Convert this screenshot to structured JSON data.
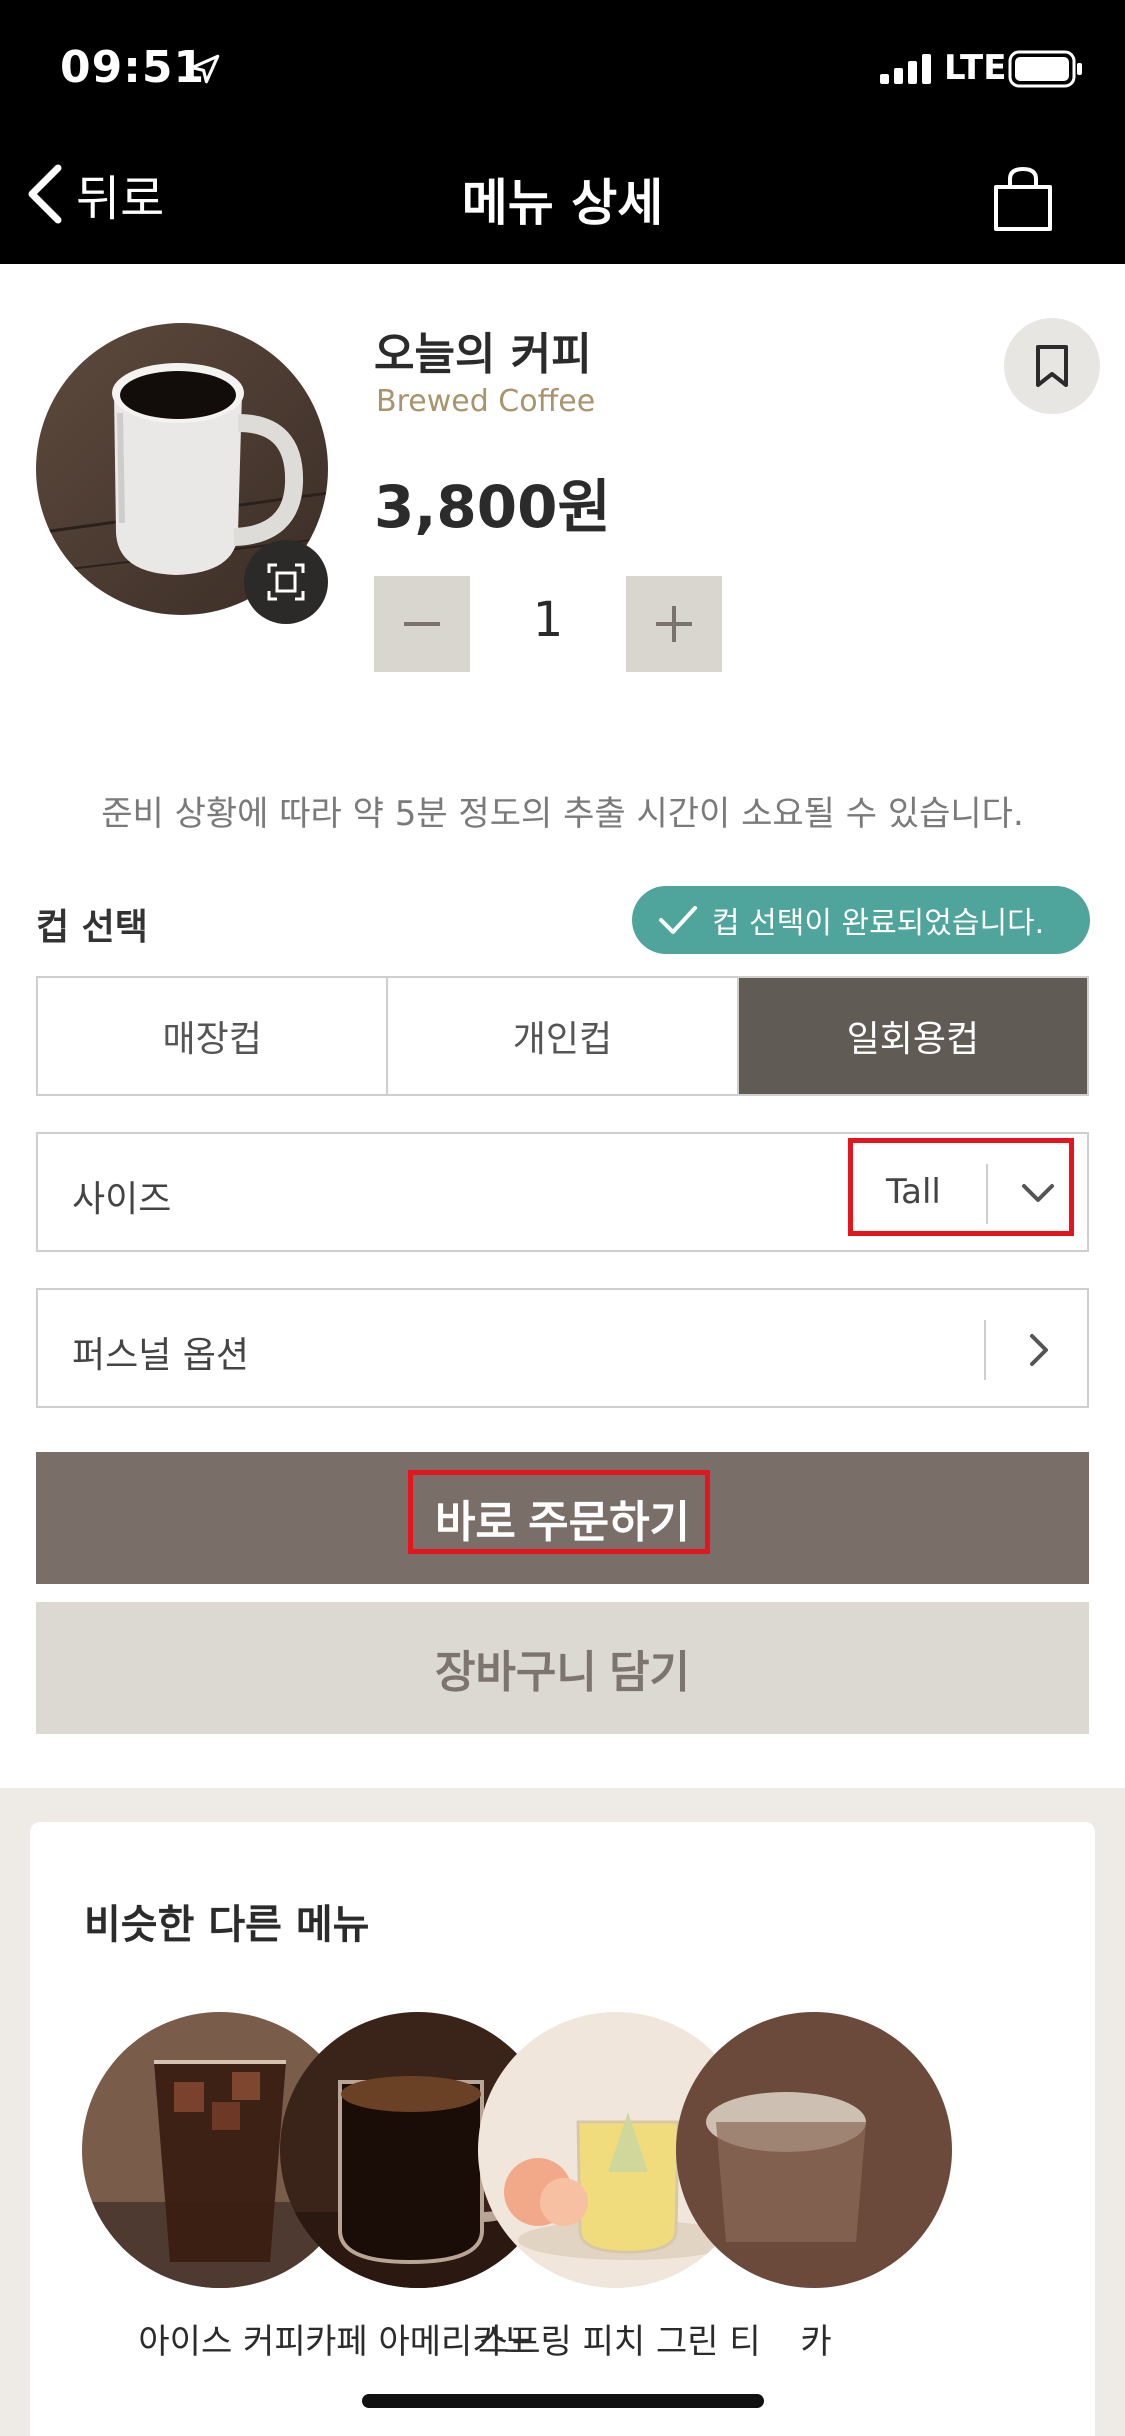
{
  "status_bar": {
    "time": "09:51",
    "network": "LTE"
  },
  "nav": {
    "back_label": "뒤로",
    "title": "메뉴 상세"
  },
  "product": {
    "name": "오늘의 커피",
    "english_name": "Brewed Coffee",
    "price": "3,800원",
    "quantity": "1"
  },
  "notice": "준비 상황에 따라 약 5분 정도의 추출 시간이 소요될 수 있습니다.",
  "cup": {
    "label": "컵 선택",
    "done_badge": "컵 선택이 완료되었습니다.",
    "options": [
      "매장컵",
      "개인컵",
      "일회용컵"
    ],
    "selected": "일회용컵"
  },
  "options": {
    "size_label": "사이즈",
    "size_value": "Tall",
    "personal_label": "퍼스널 옵션"
  },
  "actions": {
    "order_label": "바로 주문하기",
    "cart_label": "장바구니 담기"
  },
  "similar": {
    "title": "비슷한 다른 메뉴",
    "items": [
      {
        "name": "아이스 커피"
      },
      {
        "name": "카페 아메리카노"
      },
      {
        "name": "스프링 피치 그린 티"
      },
      {
        "name": "카"
      }
    ]
  },
  "colors": {
    "accent_teal": "#4fa59b",
    "brown_button": "#7a6f68",
    "selected_tab": "#615b56",
    "highlight_red": "#e3161f",
    "english_name_gold": "#a8946d"
  }
}
